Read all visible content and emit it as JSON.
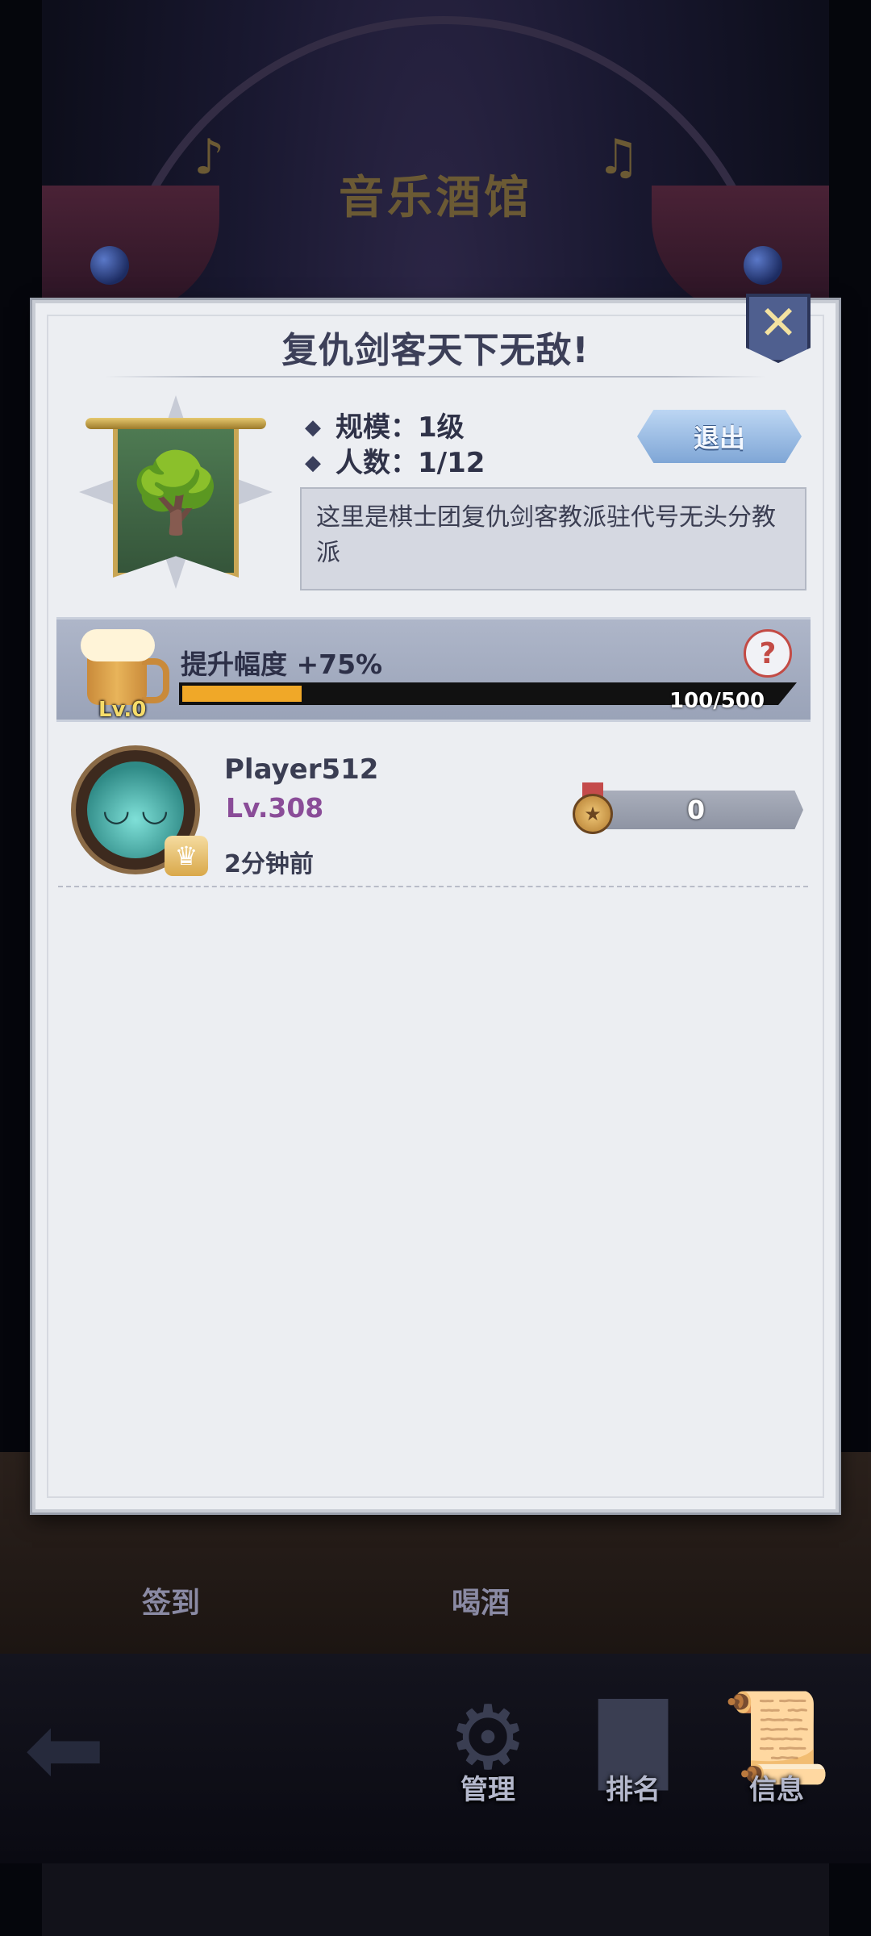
{
  "background": {
    "tavern_sign": "音乐酒馆",
    "table_labels": {
      "checkin": "签到",
      "drink": "喝酒"
    },
    "bottom_nav": [
      {
        "label": "管理",
        "icon": "gear-icon"
      },
      {
        "label": "排名",
        "icon": "podium-icon"
      },
      {
        "label": "信息",
        "icon": "scroll-icon"
      }
    ]
  },
  "dialog": {
    "title": "复仇剑客天下无敌!",
    "close_icon": "✕",
    "scale_label": "规模：1级",
    "members_label": "人数：1/12",
    "exit_label": "退出",
    "description": "这里是棋士团复仇剑客教派驻代号无头分教派",
    "boost": {
      "level": "Lv.0",
      "text": "提升幅度 +75%",
      "progress_text": "100/500",
      "progress_current": 100,
      "progress_max": 500,
      "help": "?"
    },
    "member": {
      "name": "Player512",
      "level": "Lv.308",
      "last_active": "2分钟前",
      "medal_count": "0"
    }
  },
  "colors": {
    "accent_gold": "#f0a828",
    "level_purple": "#8a4c98",
    "exit_blue": "#7fa6d6"
  }
}
